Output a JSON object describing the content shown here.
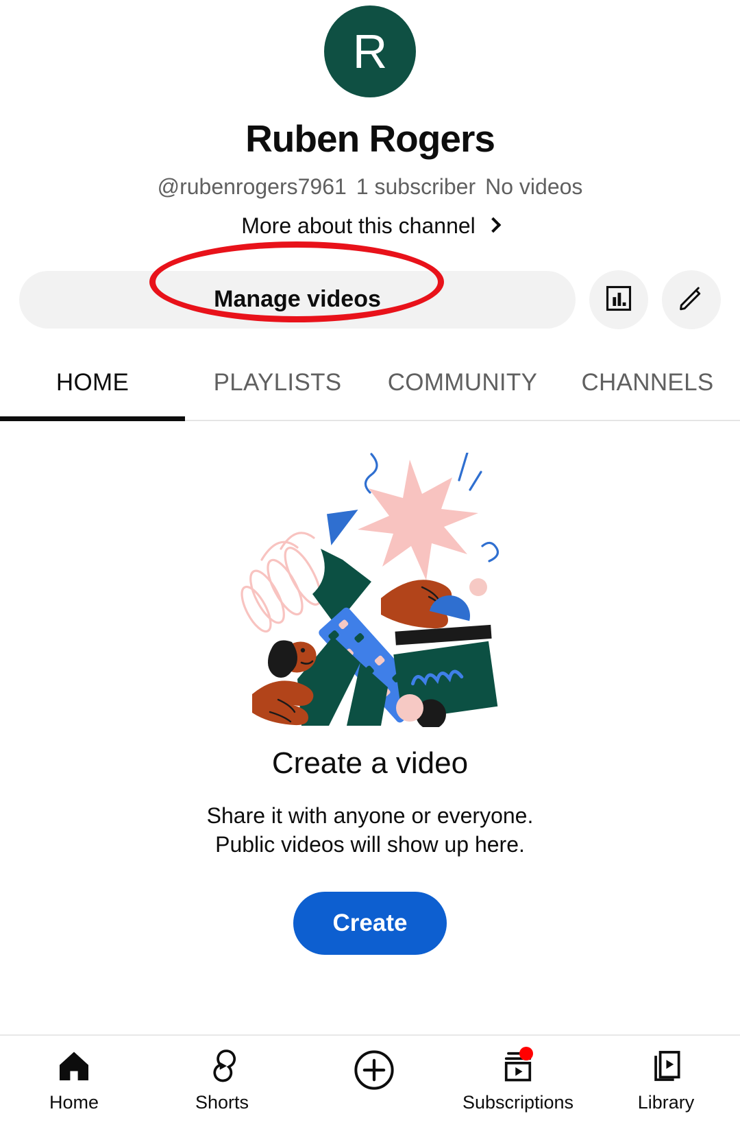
{
  "channel": {
    "avatar_letter": "R",
    "avatar_color": "#0F5043",
    "name": "Ruben Rogers",
    "handle": "@rubenrogers7961",
    "subscribers": "1 subscriber",
    "videos": "No videos",
    "more_link": "More about this channel"
  },
  "actions": {
    "manage_label": "Manage videos",
    "analytics_icon": "bar-chart-icon",
    "edit_icon": "pencil-icon",
    "annotation_color": "#e8121a"
  },
  "tabs": [
    {
      "label": "HOME",
      "active": true
    },
    {
      "label": "PLAYLISTS",
      "active": false
    },
    {
      "label": "COMMUNITY",
      "active": false
    },
    {
      "label": "CHANNELS",
      "active": false
    }
  ],
  "empty_state": {
    "title": "Create a video",
    "line1": "Share it with anyone or everyone.",
    "line2": "Public videos will show up here.",
    "button_label": "Create",
    "button_color": "#0d5fd0"
  },
  "bottom_nav": [
    {
      "label": "Home",
      "icon": "home-icon",
      "badge": false
    },
    {
      "label": "Shorts",
      "icon": "shorts-icon",
      "badge": false
    },
    {
      "label": "",
      "icon": "plus-circle-icon",
      "badge": false
    },
    {
      "label": "Subscriptions",
      "icon": "subscriptions-icon",
      "badge": true
    },
    {
      "label": "Library",
      "icon": "library-icon",
      "badge": false
    }
  ]
}
